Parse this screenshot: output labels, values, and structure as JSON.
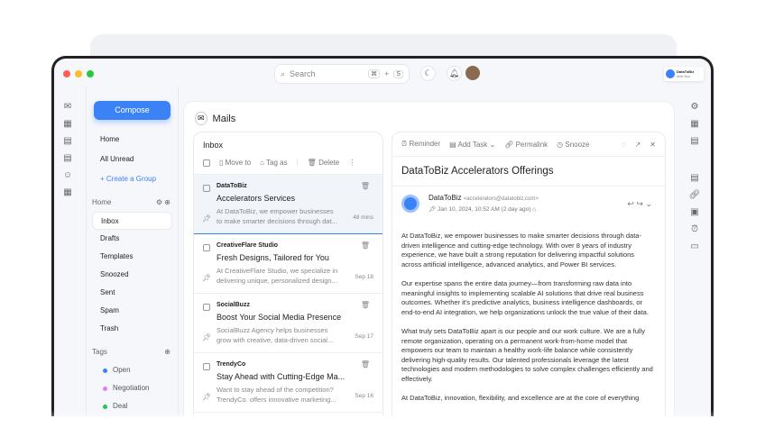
{
  "topbar": {
    "search_placeholder": "Search",
    "shortcut_cmd": "⌘",
    "shortcut_plus": "+",
    "shortcut_key": "S",
    "brand": "DataToBiz",
    "brand_sub": "Mail Box"
  },
  "sidebar": {
    "compose": "Compose",
    "top_items": [
      "Home",
      "All Unread"
    ],
    "create_group": "+ Create a Group",
    "section_home": "Home",
    "folders": [
      "Inbox",
      "Drafts",
      "Templates",
      "Snoozed",
      "Sent",
      "Spam",
      "Trash"
    ],
    "section_tags": "Tags",
    "tags": [
      {
        "label": "Open",
        "color": "#3b82f6"
      },
      {
        "label": "Negotiation",
        "color": "#e879f9"
      },
      {
        "label": "Deal",
        "color": "#22c55e"
      }
    ]
  },
  "main": {
    "title": "Mails"
  },
  "list": {
    "title": "Inbox",
    "move_to": "Move to",
    "tag_as": "Tag as",
    "delete": "Delete",
    "items": [
      {
        "from": "DataToBiz",
        "subject": "Accelerators Services",
        "preview1": "At DataToBiz, we empower businesses",
        "preview2": "to make smarter decisions through dat...",
        "date": "48 mins"
      },
      {
        "from": "CreativeFlare Studio",
        "subject": "Fresh Designs, Tailored for You",
        "preview1": "At CreativeFlare Studio, we specialize in",
        "preview2": "delivering unique, personalized design...",
        "date": "Sep 18"
      },
      {
        "from": "SocialBuzz",
        "subject": "Boost Your Social Media Presence",
        "preview1": "SocialBuzz Agency helps businesses",
        "preview2": "grow with creative, data-driven social...",
        "date": "Sep 17"
      },
      {
        "from": "TrendyCo",
        "subject": "Stay Ahead with Cutting-Edge Ma...",
        "preview1": "Want to stay ahead of the competition?",
        "preview2": "TrendyCo. offers innovative marketing...",
        "date": "Sep 16"
      }
    ]
  },
  "reader": {
    "reminder": "Reminder",
    "add_task": "Add Task",
    "permalink": "Permalink",
    "snooze": "Snooze",
    "title": "DataToBiz Accelerators Offerings",
    "sender": "DataToBiz",
    "email": "<accelerators@datatobiz.com>",
    "date": "Jan 10, 2024, 10:52 AM (2 day ago)",
    "paragraphs": [
      "At DataToBiz, we empower businesses to make smarter decisions through data-driven intelligence and cutting-edge technology. With over 8 years of industry experience, we have built a strong reputation for delivering impactful solutions across artificial intelligence, advanced analytics, and Power BI services.",
      "Our expertise spans the entire data journey—from transforming raw data into meaningful insights to implementing scalable AI solutions that drive real business outcomes. Whether it's predictive analytics, business intelligence dashboards, or end-to-end AI integration, we help organizations unlock the true value of their data.",
      "What truly sets DataToBiz apart is our people and our work culture. We are a fully remote organization, operating on a permanent work-from-home model that empowers our team to maintain a healthy work-life balance while consistently delivering high-quality results. Our talented professionals leverage the latest technologies and modern methodologies to solve complex challenges efficiently and effectively.",
      "At DataToBiz, innovation, flexibility, and excellence are at the core of everything"
    ]
  }
}
